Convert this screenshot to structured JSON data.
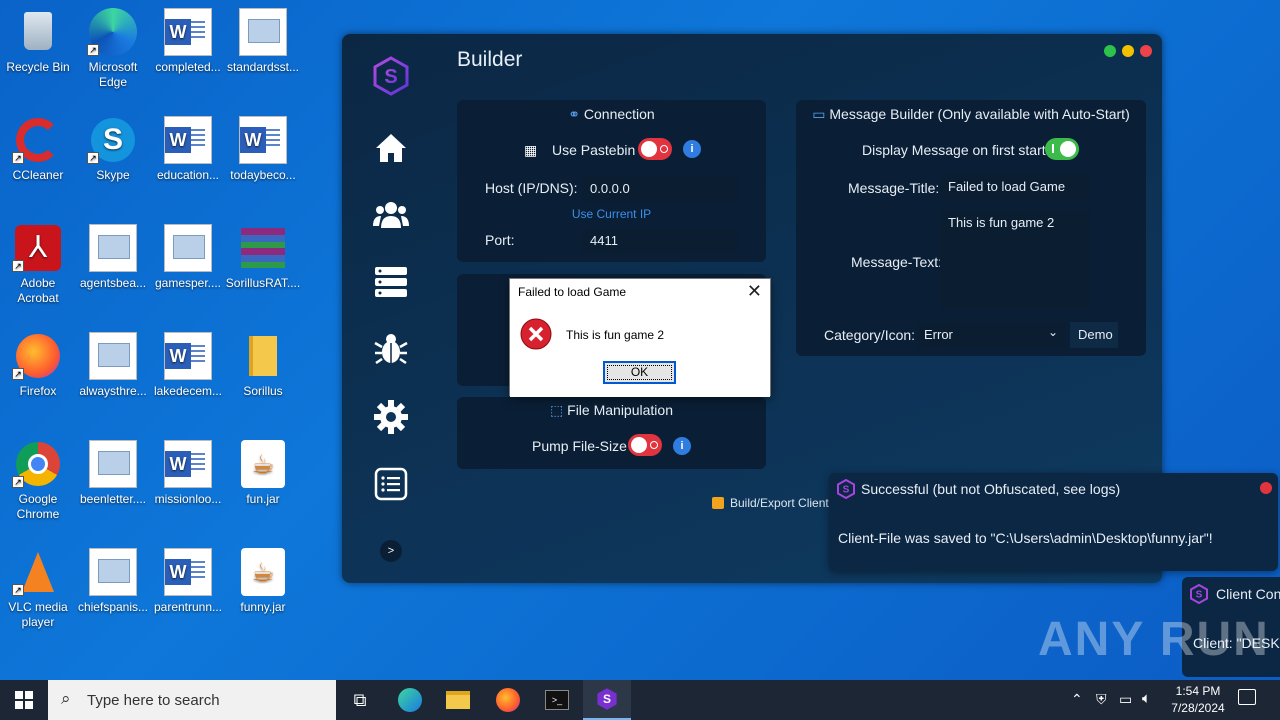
{
  "desktop": {
    "icons": [
      {
        "label": "Recycle Bin",
        "name": "recycle-bin-icon"
      },
      {
        "label": "Microsoft Edge",
        "name": "edge-icon"
      },
      {
        "label": "completed...",
        "name": "word-doc-icon"
      },
      {
        "label": "standardsst...",
        "name": "image-file-icon"
      },
      {
        "label": "CCleaner",
        "name": "ccleaner-icon"
      },
      {
        "label": "Skype",
        "name": "skype-icon"
      },
      {
        "label": "education...",
        "name": "word-doc-icon"
      },
      {
        "label": "todaybeco...",
        "name": "word-doc-icon"
      },
      {
        "label": "Adobe Acrobat",
        "name": "acrobat-icon"
      },
      {
        "label": "agentsbea...",
        "name": "image-file-icon"
      },
      {
        "label": "gamesper....",
        "name": "image-file-icon"
      },
      {
        "label": "SorillusRAT....",
        "name": "winrar-icon"
      },
      {
        "label": "Firefox",
        "name": "firefox-icon"
      },
      {
        "label": "alwaysthre...",
        "name": "image-file-icon"
      },
      {
        "label": "lakedecem...",
        "name": "word-doc-icon"
      },
      {
        "label": "Sorillus",
        "name": "folder-icon"
      },
      {
        "label": "Google Chrome",
        "name": "chrome-icon"
      },
      {
        "label": "beenletter....",
        "name": "image-file-icon"
      },
      {
        "label": "missionloo...",
        "name": "word-doc-icon"
      },
      {
        "label": "fun.jar",
        "name": "java-jar-icon"
      },
      {
        "label": "VLC media player",
        "name": "vlc-icon"
      },
      {
        "label": "chiefspanis...",
        "name": "image-file-icon"
      },
      {
        "label": "parentrunn...",
        "name": "word-doc-icon"
      },
      {
        "label": "funny.jar",
        "name": "java-jar-icon"
      }
    ]
  },
  "app": {
    "title": "Builder",
    "connection": {
      "header": "Connection",
      "use_pastebin_label": "Use Pastebin",
      "use_pastebin_on": false,
      "host_label": "Host (IP/DNS):",
      "host_value": "0.0.0.0",
      "use_current_ip": "Use Current IP",
      "port_label": "Port:",
      "port_value": "4411"
    },
    "file_manipulation": {
      "header": "File Manipulation",
      "pump_label": "Pump File-Size",
      "pump_on": false
    },
    "message_builder": {
      "header": "Message Builder (Only available with Auto-Start)",
      "display_label": "Display Message on first start",
      "display_on": true,
      "title_label": "Message-Title:",
      "title_value": "Failed to load Game",
      "text_label": "Message-Text:",
      "text_value": "This is fun game 2",
      "category_label": "Category/Icon:",
      "category_value": "Error",
      "demo_label": "Demo"
    },
    "build_label": "Build/Export Client-File"
  },
  "dialog": {
    "title": "Failed to load Game",
    "message": "This is fun game 2",
    "ok_label": "OK"
  },
  "toast": {
    "title": "Successful (but not Obfuscated, see logs)",
    "body": "Client-File was saved to \"C:\\Users\\admin\\Desktop\\funny.jar\"!"
  },
  "toast2": {
    "title": "Client Conn",
    "body": "Client: \"DESKT"
  },
  "watermark": "ANY RUN",
  "taskbar": {
    "search_placeholder": "Type here to search",
    "time": "1:54 PM",
    "date": "7/28/2024"
  },
  "colors": {
    "accent": "#2f7de1",
    "toggle_off": "#e2343f",
    "toggle_on": "#3dbb4a"
  }
}
